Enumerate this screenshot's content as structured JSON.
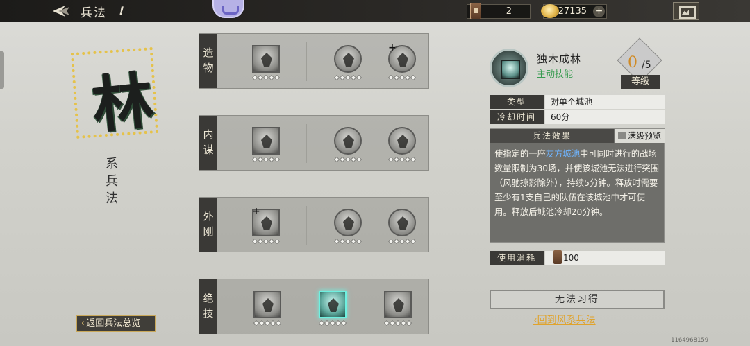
{
  "header": {
    "title": "兵法",
    "info_label": "!",
    "token_count": "2",
    "gold_count": "27135"
  },
  "left": {
    "emblem_char": "林",
    "subtitle": "系兵法",
    "back_overview": "返回兵法总览"
  },
  "rows": [
    {
      "label": "造物",
      "skills": [
        {
          "plus": false,
          "round": false
        },
        {
          "plus": false,
          "round": true
        },
        {
          "plus": true,
          "round": true
        }
      ]
    },
    {
      "label": "内谋",
      "skills": [
        {
          "plus": false,
          "round": false
        },
        {
          "plus": false,
          "round": true
        },
        {
          "plus": false,
          "round": true
        }
      ]
    },
    {
      "label": "外刚",
      "skills": [
        {
          "plus": true,
          "round": false
        },
        {
          "plus": false,
          "round": true
        },
        {
          "plus": false,
          "round": true
        }
      ]
    },
    {
      "label": "绝技",
      "skills": [
        {
          "plus": false,
          "round": false
        },
        {
          "plus": false,
          "round": false,
          "selected": true
        },
        {
          "plus": false,
          "round": false
        }
      ]
    }
  ],
  "detail": {
    "name": "独木成林",
    "type": "主动技能",
    "level_current": "0",
    "level_max": "/5",
    "level_label": "等级",
    "category_key": "类型",
    "category_value": "对单个城池",
    "cooldown_key": "冷却时间",
    "cooldown_value": "60分",
    "effect_head": "兵法效果",
    "max_preview": "满级预览",
    "effect_pre": "使指定的一座",
    "effect_highlight": "友方城池",
    "effect_post": "中可同时进行的战场数量限制为30场，并使该城池无法进行突围（风驰掠影除外），持续5分钟。释放时需要至少有1支自己的队伍在该城池中才可使用。释放后城池冷却20分钟。",
    "cost_key": "使用消耗",
    "cost_value": "100",
    "learn_button": "无法习得",
    "return_link": "回到风系兵法"
  },
  "uid": "1164968159",
  "colors": {
    "accent_gold": "#e0a32c",
    "skill_type_green": "#3a9c52",
    "highlight_blue": "#6fb4ff",
    "selected_cyan": "#6ff0e0"
  }
}
